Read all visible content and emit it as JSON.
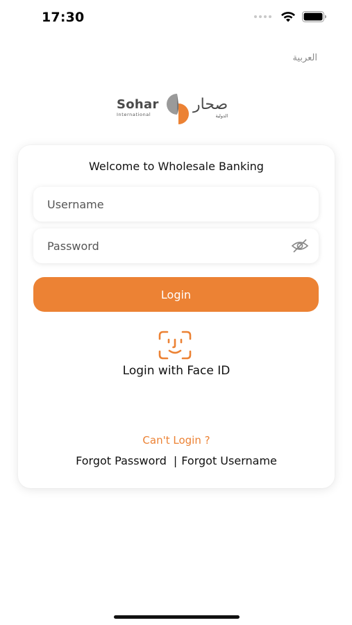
{
  "status_bar": {
    "time": "17:30",
    "icons": [
      "signal-dots-icon",
      "wifi-icon",
      "battery-icon"
    ]
  },
  "language_toggle": "العربية",
  "logo": {
    "name_en": "Sohar",
    "sub_en": "International",
    "name_ar": "صحار",
    "sub_ar": "الدولية"
  },
  "login_card": {
    "welcome": "Welcome to Wholesale Banking",
    "username_placeholder": "Username",
    "username_value": "",
    "password_placeholder": "Password",
    "password_value": "",
    "login_label": "Login",
    "face_id_label": "Login with Face ID",
    "cant_login": "Can't Login ?",
    "forgot_password": "Forgot Password",
    "separator": "|",
    "forgot_username": "Forgot Username"
  },
  "colors": {
    "accent": "#ec8234",
    "logo_grey": "#4a4a4a"
  }
}
